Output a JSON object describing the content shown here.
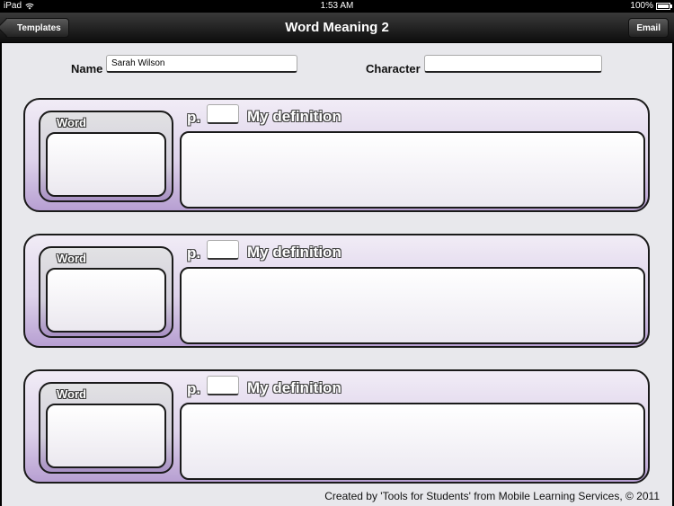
{
  "status_bar": {
    "device": "iPad",
    "time": "1:53 AM",
    "battery": "100%"
  },
  "navbar": {
    "title": "Word Meaning 2",
    "back_label": "Templates",
    "email_label": "Email"
  },
  "form": {
    "name_label": "Name",
    "name_value": "Sarah Wilson",
    "character_label": "Character",
    "character_value": ""
  },
  "cards": [
    {
      "word_label": "Word",
      "page_label": "p.",
      "definition_label": "My definition"
    },
    {
      "word_label": "Word",
      "page_label": "p.",
      "definition_label": "My definition"
    },
    {
      "word_label": "Word",
      "page_label": "p.",
      "definition_label": "My definition"
    }
  ],
  "footer": {
    "text": "Created by 'Tools for Students' from Mobile Learning Services, © 2011"
  },
  "colors": {
    "card_purple": "#b79fd2",
    "navbar": "#1a1a1a",
    "page_bg": "#e8e8ec"
  }
}
